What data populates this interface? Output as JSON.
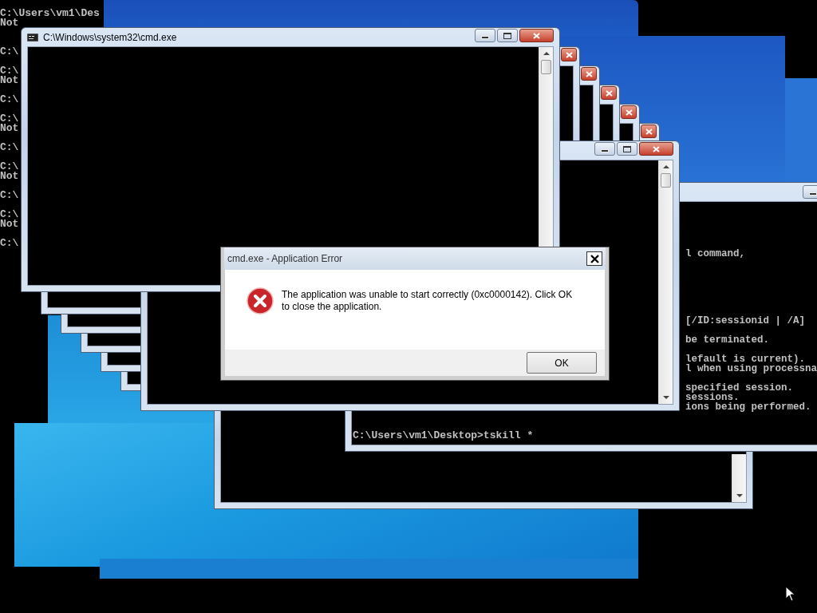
{
  "background_console": {
    "blocks": [
      [
        "C:\\Users\\vm1\\Des",
        "Not"
      ],
      [
        "C:\\"
      ],
      [
        "C:\\",
        "Not"
      ],
      [
        "C:\\"
      ],
      [
        "C:\\",
        "Not"
      ],
      [
        "C:\\"
      ],
      [
        "C:\\",
        "Not"
      ],
      [
        "C:\\"
      ],
      [
        "C:\\",
        "Not"
      ],
      [
        "C:\\"
      ]
    ]
  },
  "main_window": {
    "title": "C:\\Windows\\system32\\cmd.exe"
  },
  "console_window": {
    "output_blocks": [
      [
        "l command,"
      ],
      [
        "[/ID:sessionid | /A]"
      ],
      [
        "be terminated."
      ],
      [
        "lefault is current).",
        "l when using processna"
      ],
      [
        "specified session.",
        "sessions.",
        "ions being performed."
      ]
    ],
    "prompt": "C:\\Users\\vm1\\Desktop>tskill *"
  },
  "error_dialog": {
    "title": "cmd.exe - Application Error",
    "message": "The application was unable to start correctly (0xc0000142). Click OK to close the application.",
    "buttons": [
      "OK"
    ]
  }
}
